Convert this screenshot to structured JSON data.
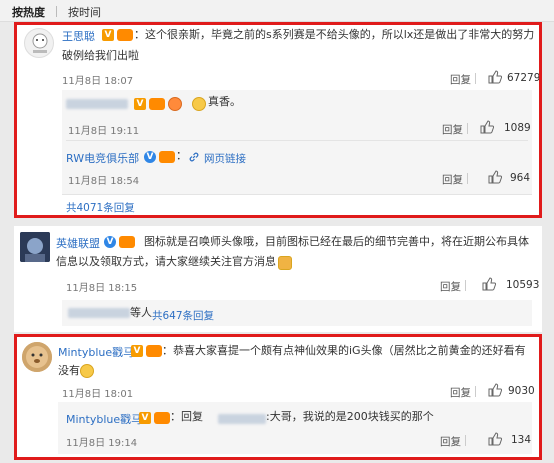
{
  "tabs": [
    {
      "label": "按热度",
      "active": true
    },
    {
      "label": "按时间",
      "active": false
    }
  ],
  "comments": [
    {
      "user": "王思聪",
      "text_line1": "：这个很亲斯，毕竟之前的s系列赛是不给头像的，所以lx还是做出了非常大的努力",
      "text_line2": "破例给我们出啦",
      "time": "11月8日 18:07",
      "reply": "回复",
      "likes": "67279",
      "replies": [
        {
          "text": "真香。",
          "time": "11月8日 19:11",
          "reply": "回复",
          "likes": "1089"
        },
        {
          "user": "RW电竞俱乐部",
          "link": "网页链接",
          "time": "11月8日 18:54",
          "reply": "回复",
          "likes": "964"
        }
      ],
      "more": "共4071条回复"
    },
    {
      "user": "英雄联盟",
      "text_line1": "图标就是召唤师头像哦，目前图标已经在最后的细节完善中，将在近期公布具体",
      "text_line2": "信息以及领取方式，请大家继续关注官方消息",
      "time": "11月8日 18:15",
      "reply": "回复",
      "likes": "10593",
      "sub_tail": "等人",
      "more": "共647条回复"
    },
    {
      "user": "Mintyblue戳马",
      "text_line1": "：恭喜大家喜提一个颇有点神仙效果的iG头像（居然比之前黄金的还好看有",
      "text_line2": "没有",
      "time": "11月8日 18:01",
      "reply": "回复",
      "likes": "9030",
      "replies": [
        {
          "user": "Mintyblue戳马",
          "prefix": "：回复",
          "suffix": ":大哥，我说的是200块钱买的那个",
          "time": "11月8日 19:14",
          "reply": "回复",
          "likes": "134"
        }
      ]
    }
  ],
  "colors": {
    "accent": "#2d6fc3",
    "frame": "#e01b1b"
  }
}
